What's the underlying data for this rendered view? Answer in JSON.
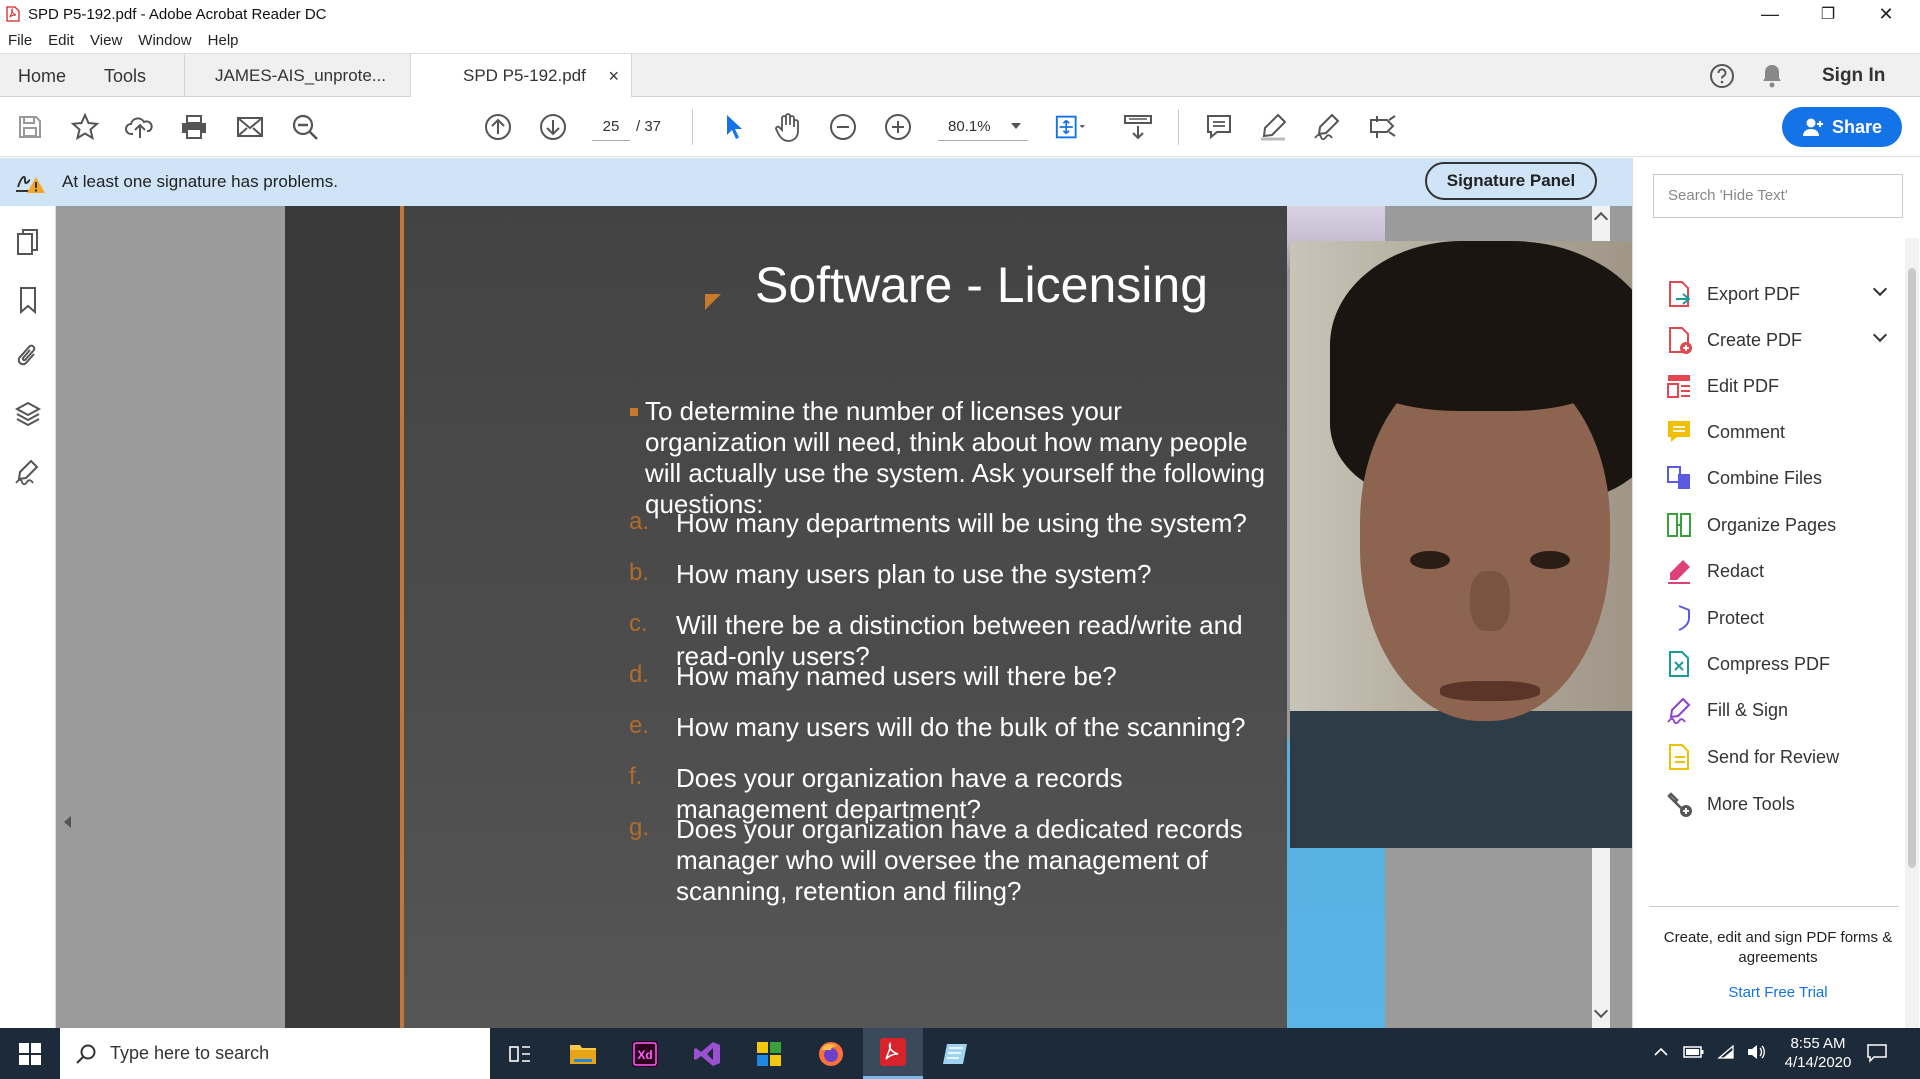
{
  "window": {
    "title": "SPD P5-192.pdf - Adobe Acrobat Reader DC",
    "controls": {
      "minimize": "—",
      "restore": "❐",
      "close": "✕"
    }
  },
  "menu": [
    "File",
    "Edit",
    "View",
    "Window",
    "Help"
  ],
  "tabs": {
    "home": "Home",
    "tools": "Tools",
    "doc1": "JAMES-AIS_unprote...",
    "doc2": "SPD P5-192.pdf",
    "close": "×"
  },
  "header_right": {
    "sign_in": "Sign In"
  },
  "toolbar": {
    "page_current": "25",
    "page_total": "/ 37",
    "zoom": "80.1%",
    "share_label": "Share"
  },
  "signature_bar": {
    "message": "At least one signature has problems.",
    "panel_button": "Signature Panel"
  },
  "slide": {
    "title": "Software - Licensing",
    "intro": "To determine the number of licenses your organization will need, think about how many people will actually use the system. Ask yourself the following questions:",
    "questions": [
      {
        "letter": "a.",
        "text": "How many departments will be using the system?"
      },
      {
        "letter": "b.",
        "text": "How many users plan to use the system?"
      },
      {
        "letter": "c.",
        "text": "Will there be a distinction between read/write and read-only users?"
      },
      {
        "letter": "d.",
        "text": "How many named users will there be?"
      },
      {
        "letter": "e.",
        "text": "How many users will do the bulk of the scanning?"
      },
      {
        "letter": "f.",
        "text": "Does your organization have a records management department?"
      },
      {
        "letter": "g.",
        "text": "Does your organization have a dedicated records manager who will oversee the management of scanning, retention and filing?"
      }
    ]
  },
  "right_pane": {
    "search_placeholder": "Search 'Hide Text'",
    "tools": [
      {
        "label": "Export PDF",
        "icon": "export-pdf-icon",
        "color": "#e34850",
        "expandable": true
      },
      {
        "label": "Create PDF",
        "icon": "create-pdf-icon",
        "color": "#e34850",
        "expandable": true
      },
      {
        "label": "Edit PDF",
        "icon": "edit-pdf-icon",
        "color": "#e34850",
        "expandable": false
      },
      {
        "label": "Comment",
        "icon": "comment-icon",
        "color": "#f0c000",
        "expandable": false
      },
      {
        "label": "Combine Files",
        "icon": "combine-files-icon",
        "color": "#5a5ae0",
        "expandable": false
      },
      {
        "label": "Organize Pages",
        "icon": "organize-pages-icon",
        "color": "#3aa13a",
        "expandable": false
      },
      {
        "label": "Redact",
        "icon": "redact-icon",
        "color": "#e0407a",
        "expandable": false
      },
      {
        "label": "Protect",
        "icon": "protect-icon",
        "color": "#5a5ae0",
        "expandable": false
      },
      {
        "label": "Compress PDF",
        "icon": "compress-pdf-icon",
        "color": "#1a9a9a",
        "expandable": false
      },
      {
        "label": "Fill & Sign",
        "icon": "fill-sign-icon",
        "color": "#8a40d0",
        "expandable": false
      },
      {
        "label": "Send for Review",
        "icon": "send-review-icon",
        "color": "#f0c000",
        "expandable": false
      },
      {
        "label": "More Tools",
        "icon": "more-tools-icon",
        "color": "#555555",
        "expandable": false
      }
    ],
    "footer": "Create, edit and sign PDF forms & agreements",
    "trial_link": "Start Free Trial"
  },
  "taskbar": {
    "search_placeholder": "Type here to search",
    "time": "8:55 AM",
    "date": "4/14/2020"
  }
}
